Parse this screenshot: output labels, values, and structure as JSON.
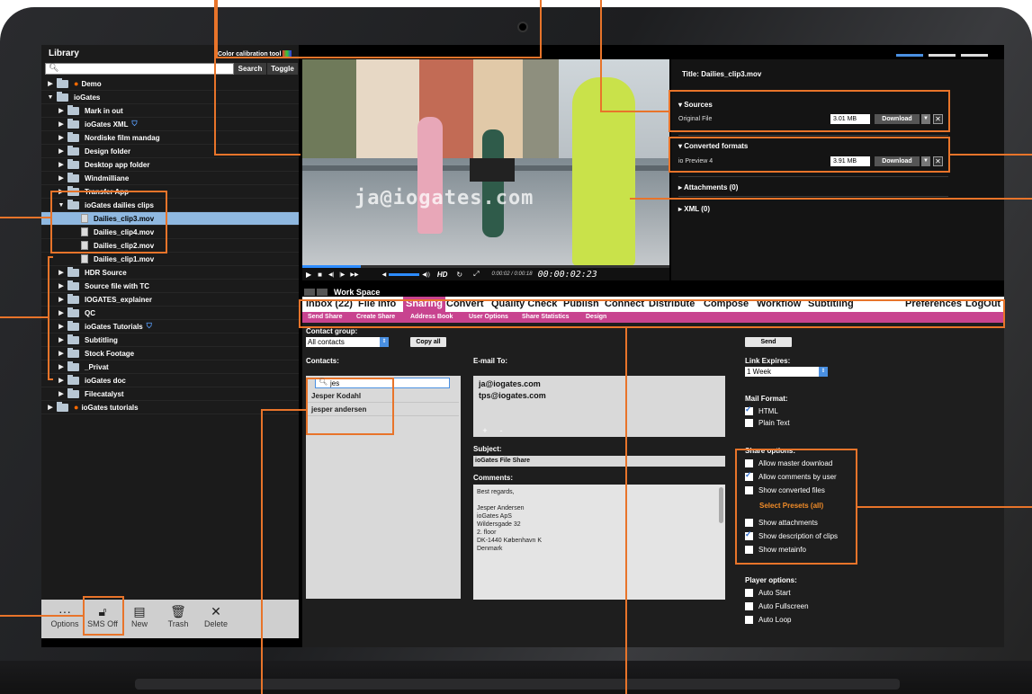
{
  "library": {
    "title": "Library",
    "search_placeholder": "",
    "search_label": "Search",
    "toggle_label": "Toggle",
    "color_calibration_label": "Color calibration tool",
    "tree": [
      {
        "label": "Demo",
        "level": 0,
        "state": "collapsed",
        "dot": true
      },
      {
        "label": "ioGates",
        "level": 0,
        "state": "expanded",
        "dot": false
      },
      {
        "label": "Mark in out",
        "level": 1,
        "state": "collapsed"
      },
      {
        "label": "ioGates XML",
        "level": 1,
        "state": "collapsed",
        "shield": true
      },
      {
        "label": "Nordiske film mandag",
        "level": 1,
        "state": "collapsed"
      },
      {
        "label": "Design folder",
        "level": 1,
        "state": "collapsed"
      },
      {
        "label": "Desktop app folder",
        "level": 1,
        "state": "collapsed"
      },
      {
        "label": "Windmilliane",
        "level": 1,
        "state": "collapsed"
      },
      {
        "label": "Transfer App",
        "level": 1,
        "state": "collapsed"
      },
      {
        "label": "ioGates dailies clips",
        "level": 1,
        "state": "expanded"
      },
      {
        "label": "Dailies_clip3.mov",
        "level": 2,
        "file": true,
        "selected": true
      },
      {
        "label": "Dailies_clip4.mov",
        "level": 2,
        "file": true
      },
      {
        "label": "Dailies_clip2.mov",
        "level": 2,
        "file": true
      },
      {
        "label": "Dailies_clip1.mov",
        "level": 2,
        "file": true
      },
      {
        "label": "HDR Source",
        "level": 1,
        "state": "collapsed"
      },
      {
        "label": "Source file with TC",
        "level": 1,
        "state": "collapsed"
      },
      {
        "label": "IOGATES_explainer",
        "level": 1,
        "state": "collapsed"
      },
      {
        "label": "QC",
        "level": 1,
        "state": "collapsed"
      },
      {
        "label": "ioGates Tutorials",
        "level": 1,
        "state": "collapsed",
        "shield": true
      },
      {
        "label": "Subtitling",
        "level": 1,
        "state": "collapsed"
      },
      {
        "label": "Stock Footage",
        "level": 1,
        "state": "collapsed"
      },
      {
        "label": "_Privat",
        "level": 1,
        "state": "collapsed"
      },
      {
        "label": "ioGates doc",
        "level": 1,
        "state": "collapsed"
      },
      {
        "label": "Filecatalyst",
        "level": 1,
        "state": "collapsed"
      },
      {
        "label": "ioGates tutorials",
        "level": 0,
        "state": "collapsed",
        "dot": true
      }
    ],
    "toolbar": {
      "options": "Options",
      "sms_off": "SMS Off",
      "new": "New",
      "trash": "Trash",
      "delete": "Delete"
    }
  },
  "player": {
    "watermark": "ja@iogates.com",
    "quality": "HD",
    "time_small": "0:00:02 / 0:00:18",
    "timecode": "00:00:02:23",
    "progress_fraction": 0.16
  },
  "info": {
    "title": "Title:  Dailies_clip3.mov",
    "sources_label": "Sources",
    "original_file_label": "Original File",
    "original_size": "3.01 MB",
    "download_label": "Download",
    "converted_label": "Converted formats",
    "preview_label": "io Preview 4",
    "preview_size": "3.91 MB",
    "attachments_label": "Attachments (0)",
    "xml_label": "XML (0)"
  },
  "workspace": {
    "title": "Work Space",
    "tabs": [
      "Inbox (22)",
      "File Info",
      "Sharing",
      "Convert",
      "Quality Check",
      "Publish",
      "Connect",
      "Distribute",
      "Compose",
      "Workflow",
      "Subtitling"
    ],
    "active_tab": "Sharing",
    "right_tabs": [
      "Preferences",
      "LogOut"
    ],
    "subtabs": [
      "Send Share",
      "Create Share",
      "Address Book",
      "User Options",
      "Share Statistics",
      "Design"
    ],
    "contact_group_label": "Contact group:",
    "contact_group_value": "All contacts",
    "copy_all_label": "Copy all",
    "send_label": "Send",
    "contacts_label": "Contacts:",
    "contact_search_value": "jes",
    "contacts": [
      "Jesper Kodahl",
      "jesper andersen"
    ],
    "email_to_label": "E-mail To:",
    "emails": [
      "ja@iogates.com",
      "tps@iogates.com"
    ],
    "add_label": "+",
    "remove_label": "-",
    "subject_label": "Subject:",
    "subject_value": "ioGates File Share",
    "comments_label": "Comments:",
    "comments_lines": [
      "Best regards,",
      "",
      "Jesper Andersen",
      "ioGates ApS",
      "Wildersgade 32",
      "2. floor",
      "DK-1440 København K",
      "Denmark"
    ],
    "link_expires_label": "Link Expires:",
    "link_expires_value": "1 Week",
    "mail_format_label": "Mail Format:",
    "mail_formats": [
      {
        "label": "HTML",
        "checked": true
      },
      {
        "label": "Plain Text",
        "checked": false
      }
    ],
    "share_options_label": "Share options:",
    "share_options": [
      {
        "label": "Allow master download",
        "checked": false
      },
      {
        "label": "Allow comments by user",
        "checked": true
      },
      {
        "label": "Show converted files",
        "checked": false
      }
    ],
    "select_presets_label": "Select Presets (all)",
    "share_options_2": [
      {
        "label": "Show attachments",
        "checked": false
      },
      {
        "label": "Show description of clips",
        "checked": true
      },
      {
        "label": "Show metainfo",
        "checked": false
      }
    ],
    "player_options_label": "Player options:",
    "player_options": [
      {
        "label": "Auto Start",
        "checked": false
      },
      {
        "label": "Auto Fullscreen",
        "checked": false
      },
      {
        "label": "Auto Loop",
        "checked": false
      }
    ]
  },
  "colors": {
    "accent": "#c8438f",
    "annotation": "#e8742a",
    "selection": "#8fb8e0",
    "presets": "#f28c28"
  }
}
